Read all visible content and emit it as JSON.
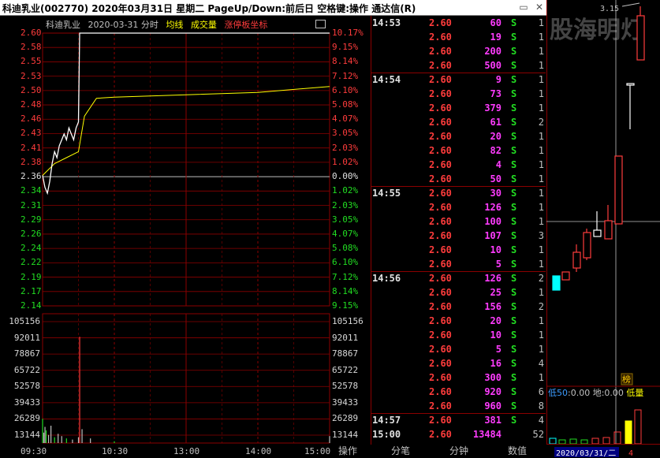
{
  "window": {
    "title": "科迪乳业(002770)  2020年03月31日 星期二  PageUp/Down:前后日  空格键:操作  通达信(R)"
  },
  "chart_head": {
    "name": "科迪乳业",
    "date_label": "2020-03-31 分时",
    "avg_label": "均线",
    "vol_label": "成交量",
    "limit_label": "涨停板坐标"
  },
  "price_axis": [
    "2.60",
    "2.58",
    "2.55",
    "2.53",
    "2.50",
    "2.48",
    "2.46",
    "2.43",
    "2.41",
    "2.38",
    "2.36",
    "2.34",
    "2.31",
    "2.29",
    "2.26",
    "2.24",
    "2.22",
    "2.19",
    "2.17",
    "2.14"
  ],
  "pct_axis": [
    "10.17%",
    "9.15%",
    "8.14%",
    "7.12%",
    "6.10%",
    "5.08%",
    "4.07%",
    "3.05%",
    "2.03%",
    "1.02%",
    "0.00%",
    "1.02%",
    "2.03%",
    "3.05%",
    "4.07%",
    "5.08%",
    "6.10%",
    "7.12%",
    "8.14%",
    "9.15%"
  ],
  "vol_axis": [
    "105156",
    "92011",
    "78867",
    "65722",
    "52578",
    "39433",
    "26289",
    "13144"
  ],
  "time_axis": [
    "09:30",
    "10:30",
    "13:00",
    "14:00",
    "15:00"
  ],
  "chart_data": {
    "type": "line",
    "title": "",
    "x_label": "",
    "y_label": "",
    "ylim": [
      2.14,
      2.6
    ],
    "prev_close": 2.36,
    "price_series": {
      "name": "分时",
      "x": [
        "09:30",
        "09:32",
        "09:34",
        "09:36",
        "09:38",
        "09:40",
        "09:42",
        "09:44",
        "09:46",
        "09:48",
        "09:50",
        "09:52",
        "09:54",
        "09:56",
        "09:58",
        "10:00",
        "10:01",
        "10:05",
        "10:30",
        "11:30/13:00",
        "14:00",
        "15:00"
      ],
      "values": [
        2.36,
        2.34,
        2.33,
        2.35,
        2.38,
        2.4,
        2.39,
        2.41,
        2.42,
        2.43,
        2.42,
        2.44,
        2.43,
        2.42,
        2.44,
        2.45,
        2.6,
        2.6,
        2.6,
        2.6,
        2.6,
        2.6
      ]
    },
    "avg_series": {
      "name": "均线",
      "x": [
        "09:30",
        "09:40",
        "09:50",
        "10:00",
        "10:05",
        "10:15",
        "10:30",
        "11:30/13:00",
        "14:00",
        "15:00"
      ],
      "values": [
        2.36,
        2.38,
        2.39,
        2.4,
        2.46,
        2.49,
        2.492,
        2.496,
        2.5,
        2.51
      ]
    },
    "volume_series": {
      "name": "成交量",
      "vol_max": 105156,
      "x": [
        "09:30",
        "09:31",
        "09:32",
        "09:33",
        "09:35",
        "09:37",
        "09:40",
        "09:43",
        "09:46",
        "09:50",
        "09:55",
        "10:00",
        "10:01",
        "10:03",
        "10:10",
        "10:30",
        "15:00"
      ],
      "values": [
        21000,
        9000,
        14000,
        11000,
        7000,
        15000,
        5000,
        8000,
        6000,
        4000,
        3000,
        5000,
        92000,
        12000,
        4000,
        1500,
        6000
      ]
    }
  },
  "ticks": [
    {
      "time": "14:53",
      "price": "2.60",
      "vol": "60",
      "side": "S",
      "count": "1"
    },
    {
      "time": "",
      "price": "2.60",
      "vol": "19",
      "side": "S",
      "count": "1"
    },
    {
      "time": "",
      "price": "2.60",
      "vol": "200",
      "side": "S",
      "count": "1"
    },
    {
      "time": "",
      "price": "2.60",
      "vol": "500",
      "side": "S",
      "count": "1"
    },
    {
      "time": "14:54",
      "price": "2.60",
      "vol": "9",
      "side": "S",
      "count": "1"
    },
    {
      "time": "",
      "price": "2.60",
      "vol": "73",
      "side": "S",
      "count": "1"
    },
    {
      "time": "",
      "price": "2.60",
      "vol": "379",
      "side": "S",
      "count": "1"
    },
    {
      "time": "",
      "price": "2.60",
      "vol": "61",
      "side": "S",
      "count": "2"
    },
    {
      "time": "",
      "price": "2.60",
      "vol": "20",
      "side": "S",
      "count": "1"
    },
    {
      "time": "",
      "price": "2.60",
      "vol": "82",
      "side": "S",
      "count": "1"
    },
    {
      "time": "",
      "price": "2.60",
      "vol": "4",
      "side": "S",
      "count": "1"
    },
    {
      "time": "",
      "price": "2.60",
      "vol": "50",
      "side": "S",
      "count": "1"
    },
    {
      "time": "14:55",
      "price": "2.60",
      "vol": "30",
      "side": "S",
      "count": "1"
    },
    {
      "time": "",
      "price": "2.60",
      "vol": "126",
      "side": "S",
      "count": "1"
    },
    {
      "time": "",
      "price": "2.60",
      "vol": "100",
      "side": "S",
      "count": "1"
    },
    {
      "time": "",
      "price": "2.60",
      "vol": "107",
      "side": "S",
      "count": "3"
    },
    {
      "time": "",
      "price": "2.60",
      "vol": "10",
      "side": "S",
      "count": "1"
    },
    {
      "time": "",
      "price": "2.60",
      "vol": "5",
      "side": "S",
      "count": "1"
    },
    {
      "time": "14:56",
      "price": "2.60",
      "vol": "126",
      "side": "S",
      "count": "2"
    },
    {
      "time": "",
      "price": "2.60",
      "vol": "25",
      "side": "S",
      "count": "1"
    },
    {
      "time": "",
      "price": "2.60",
      "vol": "156",
      "side": "S",
      "count": "2"
    },
    {
      "time": "",
      "price": "2.60",
      "vol": "20",
      "side": "S",
      "count": "1"
    },
    {
      "time": "",
      "price": "2.60",
      "vol": "10",
      "side": "S",
      "count": "1"
    },
    {
      "time": "",
      "price": "2.60",
      "vol": "5",
      "side": "S",
      "count": "1"
    },
    {
      "time": "",
      "price": "2.60",
      "vol": "16",
      "side": "S",
      "count": "4"
    },
    {
      "time": "",
      "price": "2.60",
      "vol": "300",
      "side": "S",
      "count": "1"
    },
    {
      "time": "",
      "price": "2.60",
      "vol": "920",
      "side": "S",
      "count": "6"
    },
    {
      "time": "",
      "price": "2.60",
      "vol": "960",
      "side": "S",
      "count": "8"
    },
    {
      "time": "14:57",
      "price": "2.60",
      "vol": "381",
      "side": "S",
      "count": "4"
    },
    {
      "time": "15:00",
      "price": "2.60",
      "vol": "13484",
      "side": "",
      "count": "52"
    }
  ],
  "kline": {
    "top_price": "3.15",
    "watermark": "股海明灯",
    "badge": "榜",
    "indicator_low": "低50",
    "indicator_low_val": "0.00",
    "indicator_di": "地",
    "indicator_di_val": "0.00",
    "indicator_dl": "低量",
    "date_label": "2020/03/31/二",
    "count": "4"
  },
  "bottom_tabs": [
    "操作",
    "分笔",
    "分钟",
    "数值"
  ],
  "colors": {
    "up": "#ff3c3c",
    "down": "#00ffff",
    "grid": "#8b0000",
    "price_line": "#ffffff",
    "avg_line": "#ffff00",
    "vol_bar": "#c0c0c0",
    "magenta": "#ff3cff"
  }
}
